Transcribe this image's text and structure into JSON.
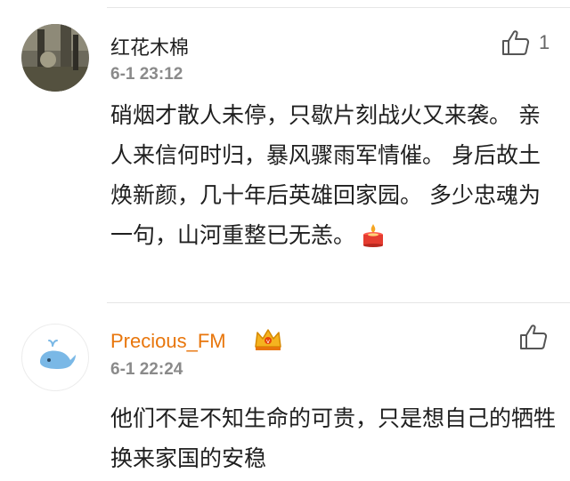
{
  "comments": [
    {
      "username": "红花木棉",
      "timestamp": "6-1 23:12",
      "likes": "1",
      "text": "硝烟才散人未停，只歇片刻战火又来袭。 亲人来信何时归，暴风骤雨军情催。 身后故土焕新颜，几十年后英雄回家园。 多少忠魂为一句，山河重整已无恙。",
      "emoji": "candle-icon"
    },
    {
      "username": "Precious_FM",
      "timestamp": "6-1 22:24",
      "text": "他们不是不知生命的可贵，只是想自己的牺牲换来家国的安稳",
      "badge": "crown-vip-icon"
    }
  ],
  "colors": {
    "vip_name": "#e8760c",
    "timestamp": "#8a8a8a",
    "divider": "#e6e6e6"
  }
}
